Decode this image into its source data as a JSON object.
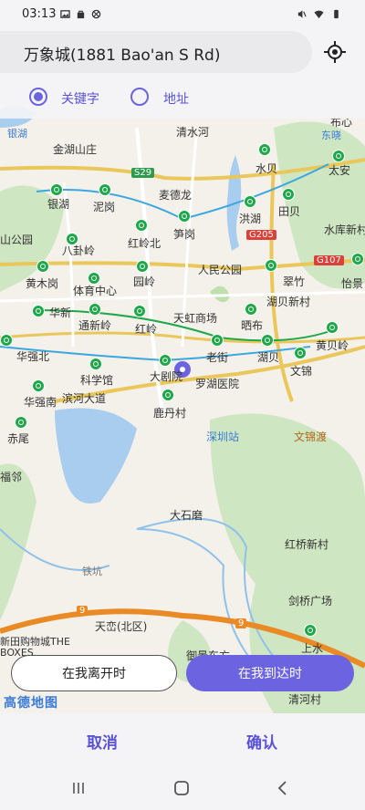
{
  "status_bar": {
    "time": "03:13"
  },
  "search": {
    "text": "万象城(1881 Bao'an S Rd)"
  },
  "mode": {
    "options": [
      "关键字",
      "地址"
    ],
    "selected": "关键字"
  },
  "map": {
    "brand": "高德地图",
    "labels": [
      "银湖",
      "金湖山庄",
      "清水河",
      "布心",
      "东晓",
      "S29",
      "麦德龙",
      "水贝",
      "太安",
      "银湖",
      "泥岗",
      "洪湖",
      "田贝",
      "山公园",
      "八卦岭",
      "红岭北",
      "笋岗",
      "G205",
      "水库新村",
      "翠竹",
      "G107",
      "黄木岗",
      "体育中心",
      "园岭",
      "人民公园",
      "怡景",
      "华新",
      "通新岭",
      "红岭",
      "天虹商场",
      "晒布",
      "湖贝新村",
      "黄贝岭",
      "华强北",
      "老街",
      "湖贝",
      "文锦",
      "科学馆",
      "大剧院",
      "罗湖医院",
      "华强南",
      "滨河大道",
      "鹿丹村",
      "深圳站",
      "文锦渡",
      "赤尾",
      "福邻",
      "大石磨",
      "红桥新村",
      "铁坑",
      "剑桥广场",
      "天峦(北区)",
      "御景东方",
      "上水",
      "清河村",
      "新田购物城THE BOXES"
    ],
    "road_badges": [
      "9",
      "9"
    ]
  },
  "buttons": {
    "leave": "在我离开时",
    "arrive": "在我到达时"
  },
  "actions": {
    "cancel": "取消",
    "confirm": "确认"
  },
  "colors": {
    "accent": "#6b63e0",
    "metro": "#1fa84a",
    "expressway": "#e98a24"
  }
}
